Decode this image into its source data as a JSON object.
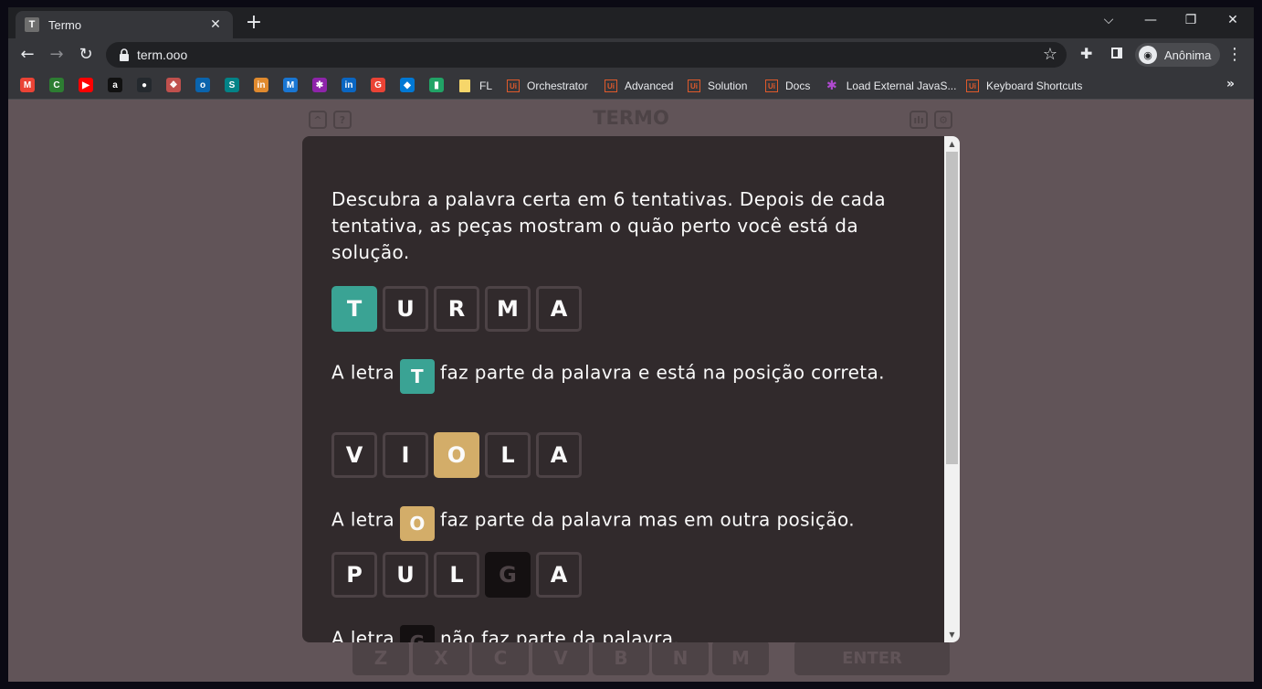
{
  "browser": {
    "tab_title": "Termo",
    "tab_favicon": "T",
    "tab_close": "✕",
    "new_tab": "+",
    "url": "term.ooo",
    "profile_label": "Anônima",
    "bookmarks": [
      {
        "icon": "gmail-icon",
        "letter": "M",
        "color": "#ea4335"
      },
      {
        "icon": "refresh-app-icon",
        "letter": "C",
        "color": "#2d7d32"
      },
      {
        "icon": "youtube-icon",
        "letter": "▶",
        "color": "#ff0000"
      },
      {
        "icon": "amazon-icon",
        "letter": "a",
        "color": "#111111"
      },
      {
        "icon": "github-icon",
        "letter": "●",
        "color": "#24292e"
      },
      {
        "icon": "puzzle-app-icon",
        "letter": "❖",
        "color": "#c0504d"
      },
      {
        "icon": "outlook-icon",
        "letter": "o",
        "color": "#0a64ad"
      },
      {
        "icon": "sharepoint-icon",
        "letter": "S",
        "color": "#038387"
      },
      {
        "icon": "hubspot-icon",
        "letter": "in",
        "color": "#e08a2e"
      },
      {
        "icon": "m-app-icon",
        "letter": "M",
        "color": "#1976d2"
      },
      {
        "icon": "asterisk-icon",
        "letter": "✱",
        "color": "#8e24aa"
      },
      {
        "icon": "linkedin-icon",
        "letter": "in",
        "color": "#0a66c2"
      },
      {
        "icon": "google-app-icon",
        "letter": "G",
        "color": "#ea4335"
      },
      {
        "icon": "cloud-app-icon",
        "letter": "◆",
        "color": "#0078d4"
      },
      {
        "icon": "shield-app-icon",
        "letter": "▮",
        "color": "#21a366"
      }
    ],
    "named_bookmarks": [
      {
        "label": "FL",
        "kind": "folder"
      },
      {
        "label": "Orchestrator",
        "kind": "ui"
      },
      {
        "label": "Advanced",
        "kind": "ui"
      },
      {
        "label": "Solution",
        "kind": "ui"
      },
      {
        "label": "Docs",
        "kind": "ui"
      },
      {
        "label": "Load External JavaS...",
        "kind": "asterisk"
      },
      {
        "label": "Keyboard Shortcuts",
        "kind": "ui"
      }
    ],
    "ui_icon_text": "Ui",
    "more_bookmarks": "»"
  },
  "game": {
    "title": "TERMO",
    "header_left": [
      "^",
      "?"
    ],
    "header_right": [
      "ılı",
      "⚙"
    ]
  },
  "modal": {
    "intro": "Descubra a palavra certa em 6 tentativas. Depois de cada tentativa, as peças mostram o quão perto você está da solução.",
    "example1": {
      "letters": [
        "T",
        "U",
        "R",
        "M",
        "A"
      ],
      "states": [
        "right",
        "",
        "",
        "",
        ""
      ],
      "prefix": "A letra",
      "highlight": "T",
      "suffix": "faz parte da palavra e está na posição correta."
    },
    "example2": {
      "letters": [
        "V",
        "I",
        "O",
        "L",
        "A"
      ],
      "states": [
        "",
        "",
        "place",
        "",
        ""
      ],
      "prefix": "A letra",
      "highlight": "O",
      "suffix": "faz parte da palavra mas em outra posição."
    },
    "example3": {
      "letters": [
        "P",
        "U",
        "L",
        "G",
        "A"
      ],
      "states": [
        "",
        "",
        "",
        "wrong",
        ""
      ],
      "prefix": "A letra",
      "highlight": "G",
      "suffix": "não faz parte da palavra."
    }
  },
  "keyboard": {
    "visible_keys": [
      "Z",
      "X",
      "C",
      "V",
      "B",
      "N",
      "M"
    ],
    "enter": "ENTER"
  },
  "colors": {
    "right": "#3aa394",
    "place": "#d3ad69",
    "wrong": "#141011",
    "background": "#615458",
    "modal": "#312a2c"
  }
}
